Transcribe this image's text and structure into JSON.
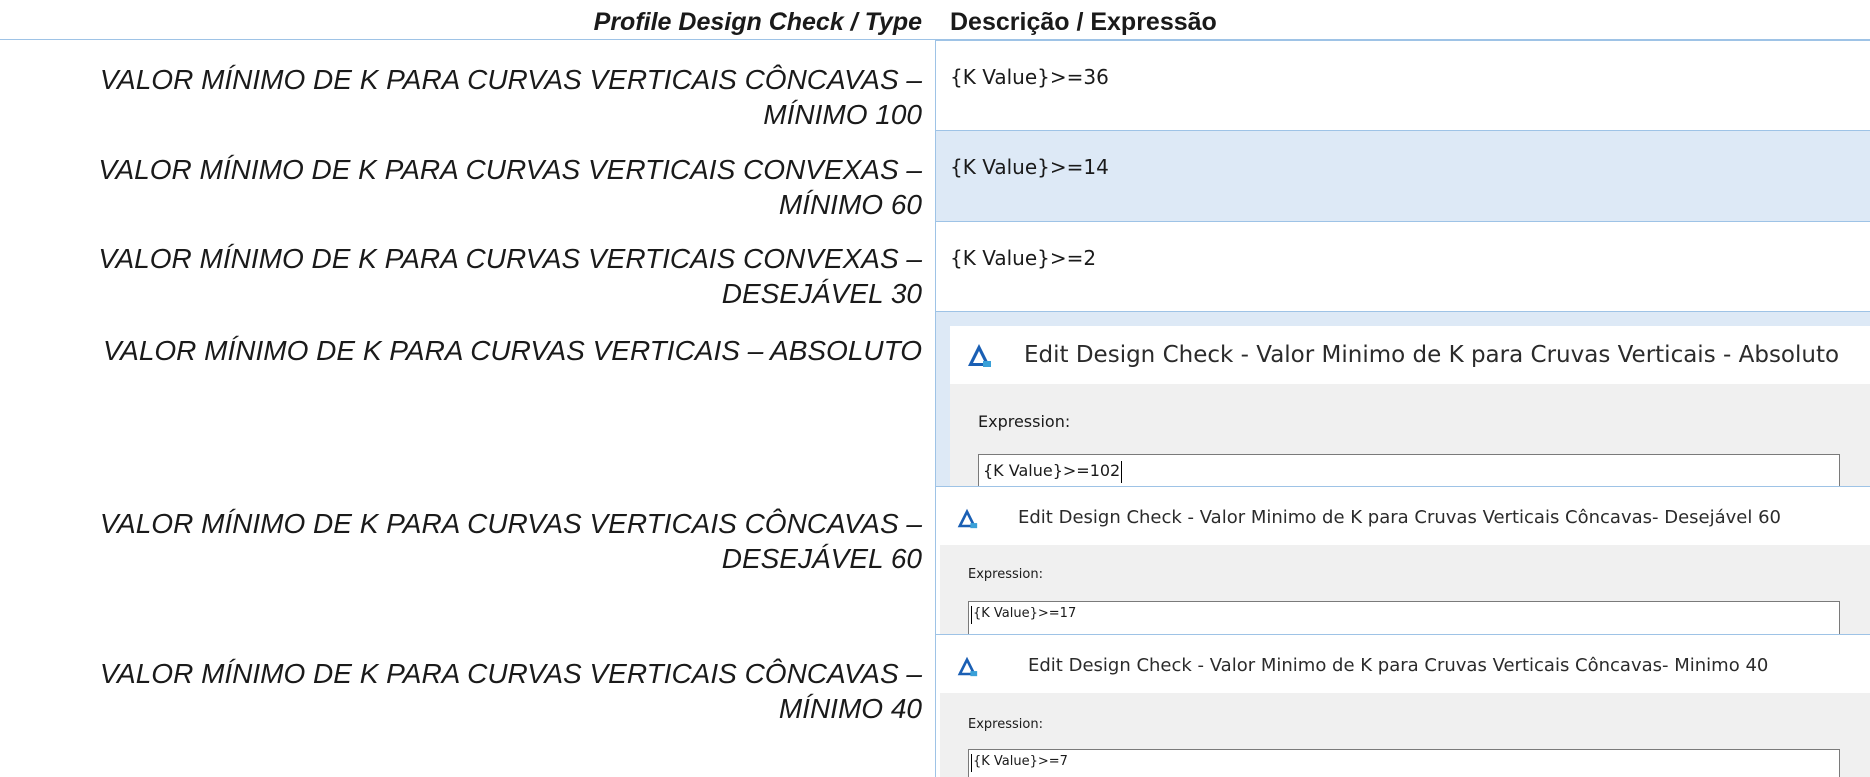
{
  "header": {
    "type_col": "Profile Design Check / Type",
    "desc_col": "Descrição / Expressão"
  },
  "rows": [
    {
      "type_line1": "VALOR MÍNIMO DE K PARA CURVAS VERTICAIS CÔNCAVAS –",
      "type_line2": "MÍNIMO 100",
      "expression": "{K Value}>=36"
    },
    {
      "type_line1": "VALOR MÍNIMO DE K PARA CURVAS VERTICAIS CONVEXAS –",
      "type_line2": "MÍNIMO 60",
      "expression": "{K Value}>=14"
    },
    {
      "type_line1": "VALOR MÍNIMO DE K PARA CURVAS VERTICAIS CONVEXAS –",
      "type_line2": "DESEJÁVEL 30",
      "expression": "{K Value}>=2"
    },
    {
      "type_line1": "VALOR MÍNIMO DE K PARA CURVAS VERTICAIS – ABSOLUTO",
      "type_line2": "",
      "dialog": {
        "title": "Edit Design Check - Valor Minimo de K para Cruvas Verticais - Absoluto",
        "expression_label": "Expression:",
        "expression_value": "{K Value}>=102",
        "icon": "autocad-civil3d-icon"
      }
    },
    {
      "type_line1": "VALOR MÍNIMO DE K PARA CURVAS VERTICAIS CÔNCAVAS –",
      "type_line2": "DESEJÁVEL 60",
      "dialog": {
        "title": "Edit Design Check - Valor Minimo de K para Cruvas Verticais Côncavas- Desejável 60",
        "expression_label": "Expression:",
        "expression_value": "{K Value}>=17",
        "icon": "autocad-civil3d-icon"
      }
    },
    {
      "type_line1": "VALOR MÍNIMO DE K PARA CURVAS VERTICAIS CÔNCAVAS –",
      "type_line2": "MÍNIMO 40",
      "dialog": {
        "title": "Edit Design Check - Valor Minimo de K para Cruvas Verticais Côncavas- Minimo 40",
        "expression_label": "Expression:",
        "expression_value": "{K Value}>=7",
        "icon": "autocad-civil3d-icon"
      }
    }
  ],
  "colors": {
    "border": "#9ec3e6",
    "shaded_row": "#dde9f6",
    "dialog_bg": "#f0f0f0",
    "icon_blue": "#1a5fb4"
  }
}
